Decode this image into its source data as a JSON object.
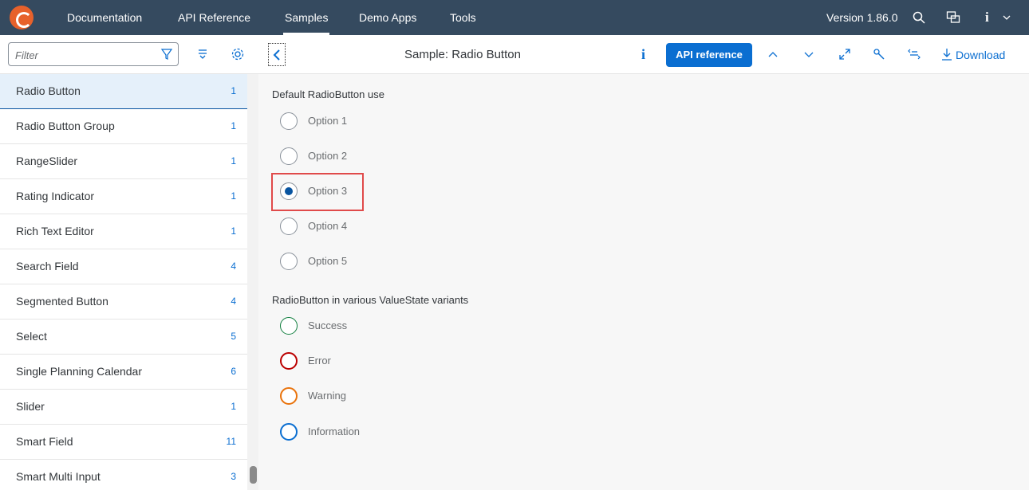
{
  "shell": {
    "nav": [
      "Documentation",
      "API Reference",
      "Samples",
      "Demo Apps",
      "Tools"
    ],
    "active_nav": "Samples",
    "version": "Version 1.86.0",
    "info_glyph": "i"
  },
  "toolbar": {
    "filter_placeholder": "Filter",
    "sample_title": "Sample: Radio Button",
    "info_glyph": "i",
    "api_button": "API reference",
    "download": "Download"
  },
  "sidebar": {
    "items": [
      {
        "label": "Radio Button",
        "count": "1"
      },
      {
        "label": "Radio Button Group",
        "count": "1"
      },
      {
        "label": "RangeSlider",
        "count": "1"
      },
      {
        "label": "Rating Indicator",
        "count": "1"
      },
      {
        "label": "Rich Text Editor",
        "count": "1"
      },
      {
        "label": "Search Field",
        "count": "4"
      },
      {
        "label": "Segmented Button",
        "count": "4"
      },
      {
        "label": "Select",
        "count": "5"
      },
      {
        "label": "Single Planning Calendar",
        "count": "6"
      },
      {
        "label": "Slider",
        "count": "1"
      },
      {
        "label": "Smart Field",
        "count": "11"
      },
      {
        "label": "Smart Multi Input",
        "count": "3"
      }
    ],
    "selected": "Radio Button"
  },
  "main": {
    "section1_title": "Default RadioButton use",
    "options": [
      "Option 1",
      "Option 2",
      "Option 3",
      "Option 4",
      "Option 5"
    ],
    "selected_option": "Option 3",
    "section2_title": "RadioButton in various ValueState variants",
    "states": [
      "Success",
      "Error",
      "Warning",
      "Information"
    ]
  },
  "colors": {
    "shell_bg": "#354a5f",
    "accent": "#0a6ed1",
    "success": "#107e3e",
    "error": "#bb0000",
    "warning": "#e9730c",
    "information": "#0a6ed1",
    "highlight_box": "#e04a4a"
  }
}
